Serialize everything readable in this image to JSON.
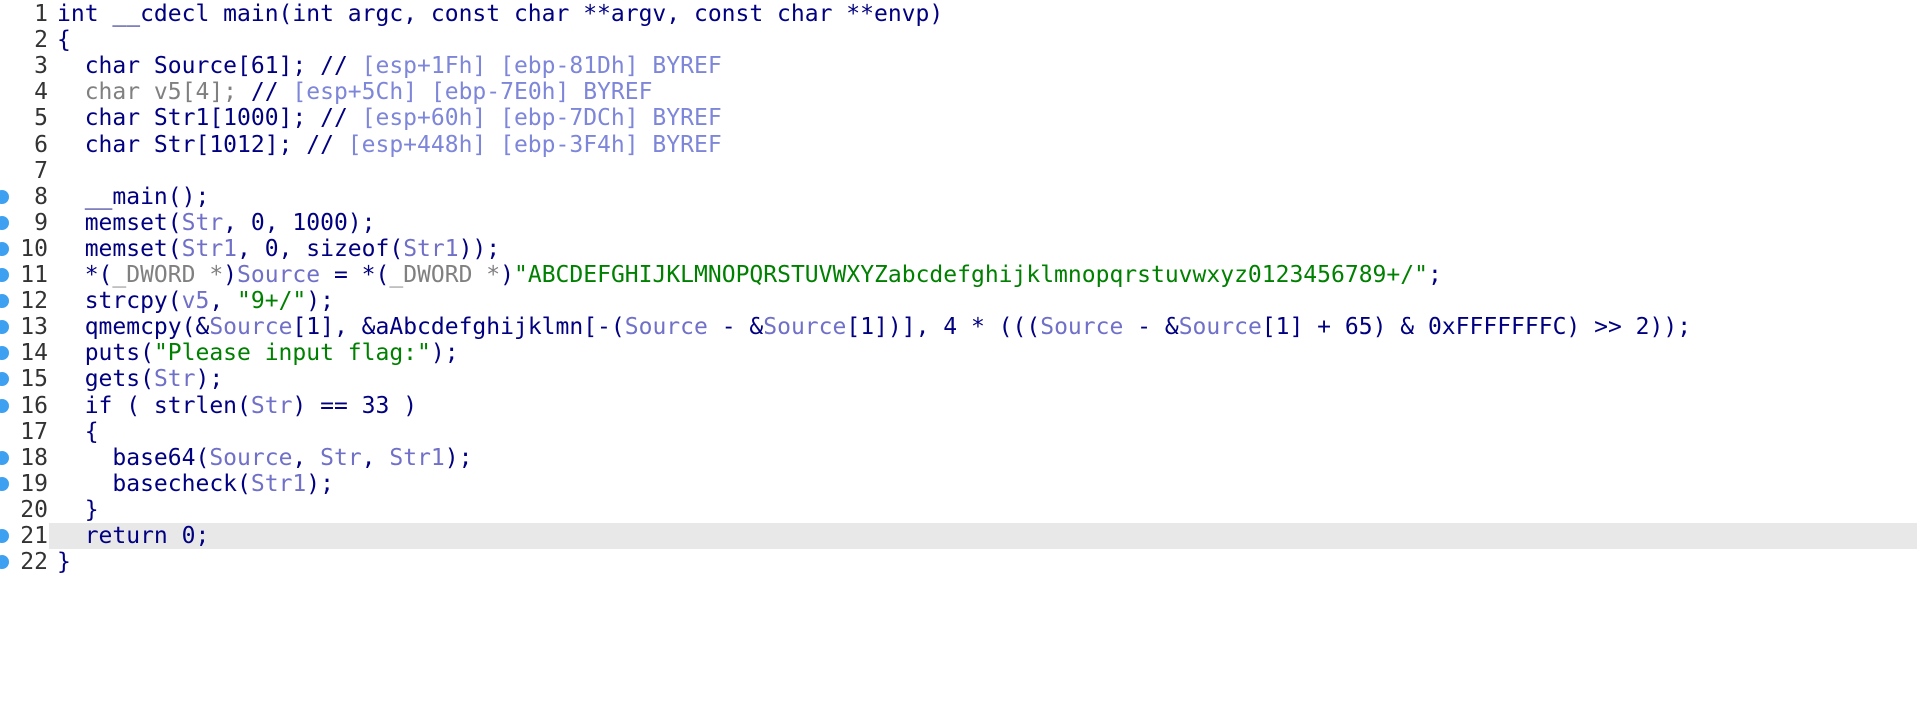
{
  "editor": {
    "lines": [
      {
        "n": "1",
        "bp": false,
        "current": false,
        "tokens": [
          {
            "t": "int __cdecl main(int argc, const char **argv, const char **envp)",
            "c": "kw"
          }
        ]
      },
      {
        "n": "2",
        "bp": false,
        "current": false,
        "tokens": [
          {
            "t": "{",
            "c": "op"
          }
        ]
      },
      {
        "n": "3",
        "bp": false,
        "current": false,
        "tokens": [
          {
            "t": "  char Source[61]; // ",
            "c": "kw"
          },
          {
            "t": "[esp+1Fh] [ebp-81Dh] BYREF",
            "c": "cm"
          }
        ]
      },
      {
        "n": "4",
        "bp": false,
        "current": false,
        "tokens": [
          {
            "t": "  char v5[4]; ",
            "c": "gray"
          },
          {
            "t": "// ",
            "c": "kw"
          },
          {
            "t": "[esp+5Ch] [ebp-7E0h] BYREF",
            "c": "cm"
          }
        ]
      },
      {
        "n": "5",
        "bp": false,
        "current": false,
        "tokens": [
          {
            "t": "  char Str1[1000]; // ",
            "c": "kw"
          },
          {
            "t": "[esp+60h] [ebp-7DCh] BYREF",
            "c": "cm"
          }
        ]
      },
      {
        "n": "6",
        "bp": false,
        "current": false,
        "tokens": [
          {
            "t": "  char Str[1012]; // ",
            "c": "kw"
          },
          {
            "t": "[esp+448h] [ebp-3F4h] BYREF",
            "c": "cm"
          }
        ]
      },
      {
        "n": "7",
        "bp": false,
        "current": false,
        "tokens": []
      },
      {
        "n": "8",
        "bp": true,
        "current": false,
        "tokens": [
          {
            "t": "  __main();",
            "c": "fn"
          }
        ]
      },
      {
        "n": "9",
        "bp": true,
        "current": false,
        "tokens": [
          {
            "t": "  memset(",
            "c": "fn"
          },
          {
            "t": "Str",
            "c": "var"
          },
          {
            "t": ", 0, 1000);",
            "c": "op"
          }
        ]
      },
      {
        "n": "10",
        "bp": true,
        "current": false,
        "tokens": [
          {
            "t": "  memset(",
            "c": "fn"
          },
          {
            "t": "Str1",
            "c": "var"
          },
          {
            "t": ", 0, sizeof(",
            "c": "op"
          },
          {
            "t": "Str1",
            "c": "var"
          },
          {
            "t": "));",
            "c": "op"
          }
        ]
      },
      {
        "n": "11",
        "bp": true,
        "current": false,
        "tokens": [
          {
            "t": "  *(",
            "c": "op"
          },
          {
            "t": "_DWORD *",
            "c": "gray"
          },
          {
            "t": ")",
            "c": "op"
          },
          {
            "t": "Source",
            "c": "var"
          },
          {
            "t": " = *(",
            "c": "op"
          },
          {
            "t": "_DWORD *",
            "c": "gray"
          },
          {
            "t": ")",
            "c": "op"
          },
          {
            "t": "\"ABCDEFGHIJKLMNOPQRSTUVWXYZabcdefghijklmnopqrstuvwxyz0123456789+/\"",
            "c": "str"
          },
          {
            "t": ";",
            "c": "op"
          }
        ]
      },
      {
        "n": "12",
        "bp": true,
        "current": false,
        "tokens": [
          {
            "t": "  strcpy(",
            "c": "fn"
          },
          {
            "t": "v5",
            "c": "var"
          },
          {
            "t": ", ",
            "c": "op"
          },
          {
            "t": "\"9+/\"",
            "c": "str"
          },
          {
            "t": ");",
            "c": "op"
          }
        ]
      },
      {
        "n": "13",
        "bp": true,
        "current": false,
        "tokens": [
          {
            "t": "  qmemcpy(&",
            "c": "fn"
          },
          {
            "t": "Source",
            "c": "var"
          },
          {
            "t": "[1], &aAbcdefghijklmn[-(",
            "c": "op"
          },
          {
            "t": "Source",
            "c": "var"
          },
          {
            "t": " - &",
            "c": "op"
          },
          {
            "t": "Source",
            "c": "var"
          },
          {
            "t": "[1])], 4 * (((",
            "c": "op"
          },
          {
            "t": "Source",
            "c": "var"
          },
          {
            "t": " - &",
            "c": "op"
          },
          {
            "t": "Source",
            "c": "var"
          },
          {
            "t": "[1] + 65) & 0xFFFFFFFC) >> 2));",
            "c": "op"
          }
        ]
      },
      {
        "n": "14",
        "bp": true,
        "current": false,
        "tokens": [
          {
            "t": "  puts(",
            "c": "fn"
          },
          {
            "t": "\"Please input flag:\"",
            "c": "str"
          },
          {
            "t": ");",
            "c": "op"
          }
        ]
      },
      {
        "n": "15",
        "bp": true,
        "current": false,
        "tokens": [
          {
            "t": "  gets(",
            "c": "fn"
          },
          {
            "t": "Str",
            "c": "var"
          },
          {
            "t": ");",
            "c": "op"
          }
        ]
      },
      {
        "n": "16",
        "bp": true,
        "current": false,
        "tokens": [
          {
            "t": "  if ( strlen(",
            "c": "kw"
          },
          {
            "t": "Str",
            "c": "var"
          },
          {
            "t": ") == 33 )",
            "c": "op"
          }
        ]
      },
      {
        "n": "17",
        "bp": false,
        "current": false,
        "tokens": [
          {
            "t": "  {",
            "c": "op"
          }
        ]
      },
      {
        "n": "18",
        "bp": true,
        "current": false,
        "tokens": [
          {
            "t": "    base64(",
            "c": "fn"
          },
          {
            "t": "Source",
            "c": "var"
          },
          {
            "t": ", ",
            "c": "op"
          },
          {
            "t": "Str",
            "c": "var"
          },
          {
            "t": ", ",
            "c": "op"
          },
          {
            "t": "Str1",
            "c": "var"
          },
          {
            "t": ");",
            "c": "op"
          }
        ]
      },
      {
        "n": "19",
        "bp": true,
        "current": false,
        "tokens": [
          {
            "t": "    basecheck(",
            "c": "fn"
          },
          {
            "t": "Str1",
            "c": "var"
          },
          {
            "t": ");",
            "c": "op"
          }
        ]
      },
      {
        "n": "20",
        "bp": false,
        "current": false,
        "tokens": [
          {
            "t": "  }",
            "c": "op"
          }
        ]
      },
      {
        "n": "21",
        "bp": true,
        "current": true,
        "tokens": [
          {
            "t": "  return 0;",
            "c": "kw"
          }
        ]
      },
      {
        "n": "22",
        "bp": true,
        "current": false,
        "tokens": [
          {
            "t": "}",
            "c": "op"
          }
        ]
      }
    ]
  }
}
